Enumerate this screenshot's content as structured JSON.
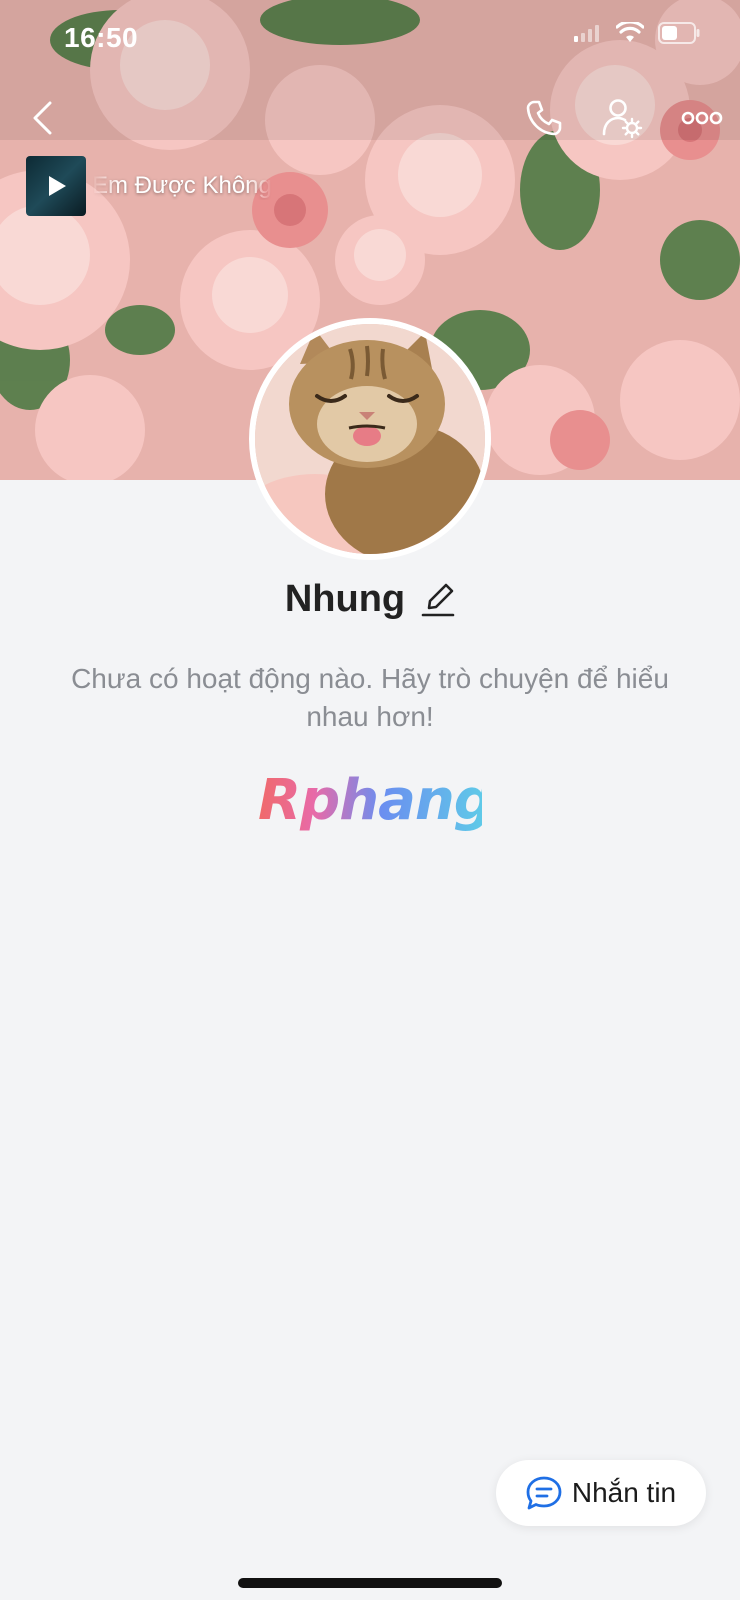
{
  "status_bar": {
    "time": "16:50"
  },
  "music": {
    "title": "Em Được Không"
  },
  "profile": {
    "name": "Nhung",
    "empty_message": "Chưa có hoạt động nào. Hãy trò chuyện để hiểu nhau hơn!"
  },
  "watermark": {
    "text": "Rphang"
  },
  "actions": {
    "message_label": "Nhắn tin"
  },
  "icons": {
    "back": "chevron-left-icon",
    "call": "phone-icon",
    "user_settings": "user-gear-icon",
    "more": "more-icon",
    "chat": "chat-bubble-icon"
  },
  "colors": {
    "accent": "#1f6fe5",
    "background": "#f3f4f6"
  }
}
